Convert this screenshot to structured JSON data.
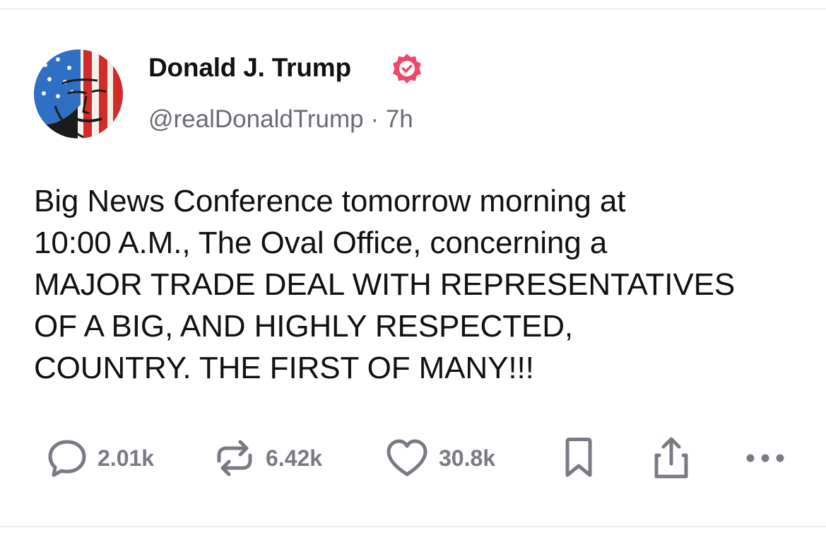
{
  "post": {
    "author": {
      "display_name": "Donald J. Trump",
      "handle": "@realDonaldTrump",
      "separator": "·",
      "time_ago": "7h",
      "verified": true,
      "verified_color": "#f0466a"
    },
    "text": "Big News Conference tomorrow morning at\n10:00 A.M., The Oval Office, concerning a\nMAJOR TRADE DEAL WITH REPRESENTATIVES\nOF A BIG, AND HIGHLY RESPECTED,\nCOUNTRY. THE FIRST OF MANY!!!",
    "actions": {
      "reply_count": "2.01k",
      "repost_count": "6.42k",
      "like_count": "30.8k"
    },
    "icons": [
      "reply-icon",
      "repost-icon",
      "like-icon",
      "bookmark-icon",
      "share-icon",
      "more-icon"
    ],
    "colors": {
      "text": "#111111",
      "secondary": "#6b6b74",
      "action": "#7a7a84",
      "verified": "#f0466a"
    }
  }
}
